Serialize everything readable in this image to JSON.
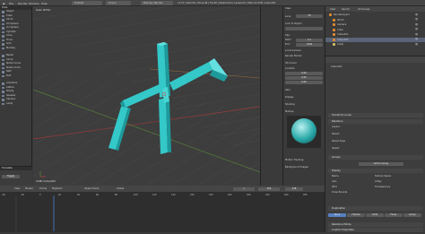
{
  "topbar": {
    "menus": [
      "File",
      "Render",
      "Window",
      "Help"
    ],
    "layout_label": "Default",
    "scene_label": "Scene",
    "engine_label": "Blender Render",
    "info_text": "v2.79 | Verts:56 | Faces:48 | Tris:96 | Objects:0/4 | Lamps:0/1 | Mem:12.23M | Cube.002"
  },
  "tools": {
    "header": "Tools",
    "items": [
      "Object",
      "Cube",
      "Circle",
      "UV Sphere",
      "Ico Sphere",
      "Cylinder",
      "Cone",
      "Torus",
      "Grid",
      "Monkey",
      "Bezier",
      "Circle",
      "Nurbs Curve",
      "Nurbs Circle",
      "Path",
      "Text",
      "Armature",
      "Lattice",
      "Empty",
      "Speaker",
      "Camera",
      "Lamp"
    ],
    "redo_header": "Translate",
    "redo_value": "Toggle"
  },
  "viewport": {
    "header": "User Ortho",
    "footer": "(248) Cube.002",
    "mode": "Object Mode",
    "pivot": "Global"
  },
  "npanel": {
    "labels": [
      "View",
      "Lens:",
      "Lock to Object",
      "Clip:",
      "Start:",
      "End:",
      "Local Camera",
      "Render Border",
      "3D Cursor",
      "Location",
      "X:",
      "Y:",
      "Z:",
      "Item",
      "Display",
      "Shading",
      "Matcap",
      "Motion Tracking",
      "Background Images"
    ],
    "lens_value": "35",
    "start_value": "0.1",
    "end_value": "1000",
    "x_value": "0.00",
    "y_value": "0.00",
    "z_value": "0.00"
  },
  "outliner": {
    "header_items": [
      "View",
      "Search",
      "All Scenes"
    ],
    "rows": [
      "RenderLayers",
      "World",
      "Camera",
      "Cube",
      "Cube.001",
      "Cube.002",
      "Lamp"
    ]
  },
  "props": {
    "header": "Cube.002",
    "sections": [
      "Transform Locks",
      "Relations",
      "Layers:",
      "Parent:",
      "Parent Type",
      "Object",
      "Groups",
      "Add to Group",
      "Display",
      "Name",
      "Axis",
      "Wire",
      "Draw Bounds",
      "Texture Space",
      "X-Ray",
      "Transparency",
      "Duplication",
      "Relations Extras",
      "Custom Properties"
    ],
    "add_to_group_button": "Add to Group",
    "dup_tabs": [
      "None",
      "Frames",
      "Verts",
      "Faces",
      "Group"
    ]
  },
  "timeline": {
    "menus": [
      "View",
      "Marker",
      "Frame",
      "Playback"
    ],
    "start_label": "Start:",
    "start_value": "1",
    "end_label": "End:",
    "end_value": "250",
    "current_value": "248",
    "ticks": [
      "-40",
      "-20",
      "0",
      "20",
      "40",
      "60",
      "80",
      "100",
      "120",
      "140",
      "160",
      "180",
      "200",
      "220",
      "240",
      "260",
      "280"
    ]
  },
  "colors": {
    "object_cyan": "#34c8c8",
    "object_cyan_dark": "#1d9a9c",
    "object_cyan_light": "#64e0e0",
    "grid_major": "#4a4a4a",
    "axis_red": "#9a3a3a",
    "axis_green": "#5a8a3a",
    "accent_blue": "#5680c2"
  }
}
